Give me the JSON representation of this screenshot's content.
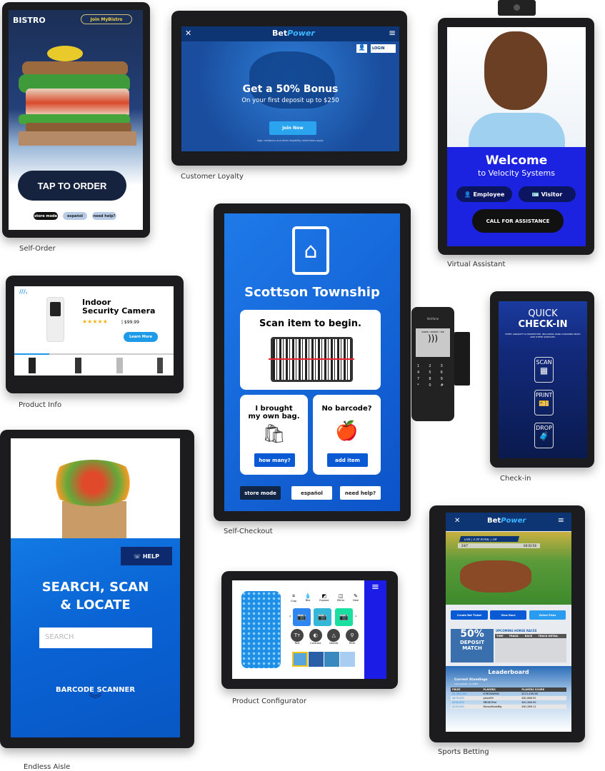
{
  "self_order": {
    "label": "Self-Order",
    "brand": "BISTRO",
    "join": "Join MyBistro",
    "cta": "TAP TO ORDER",
    "buttons": [
      "store mode",
      "español",
      "need help?"
    ]
  },
  "customer_loyalty": {
    "label": "Customer Loyalty",
    "logo_a": "Bet",
    "logo_b": "Power",
    "login": "LOGIN",
    "headline": "Get a 50% Bonus",
    "sub": "On your first deposit up to $250",
    "cta": "Join Now",
    "fine": "Age, residency and other eligibility restrictions apply"
  },
  "virtual_assistant": {
    "label": "Virtual Assistant",
    "welcome": "Welcome",
    "to": "to Velocity Systems",
    "employee": "Employee",
    "visitor": "Visitor",
    "call": "CALL FOR ASSISTANCE"
  },
  "product_info": {
    "label": "Product Info",
    "title1": "Indoor",
    "title2": "Security Camera",
    "stars": "★★★★★",
    "rating": 5,
    "price": "| $99.99",
    "cta": "Learn More",
    "progress": 0.22
  },
  "self_checkout": {
    "label": "Self-Checkout",
    "title": "Scottson Township",
    "scan": "Scan item to begin.",
    "bag_title1": "I brought",
    "bag_title2": "my own bag.",
    "bag_btn": "how many?",
    "nobar_title": "No barcode?",
    "nobar_btn": "add item",
    "footer": [
      "store mode",
      "español",
      "need help?"
    ],
    "reader_brand": "Verifone",
    "reader_screen": "SWIPE / INSERT / TAP",
    "keys": [
      "1",
      "2",
      "3",
      "4",
      "5",
      "6",
      "7",
      "8",
      "9",
      "*",
      "0",
      "#"
    ]
  },
  "check_in": {
    "label": "Check-in",
    "title1": "QUICK",
    "title2": "CHECK-IN",
    "note": "EVERY AIRCRAFT IS DISINFECTED, INCLUDING HAND-CLEANING SEATS AND OTHER SURFACES.",
    "options": [
      "SCAN",
      "PRINT",
      "DROP"
    ]
  },
  "endless_aisle": {
    "label": "Endless Aisle",
    "help": "HELP",
    "title1": "SEARCH, SCAN",
    "title2": "& LOCATE",
    "search_placeholder": "SEARCH",
    "barcode": "BARCODE SCANNER"
  },
  "product_configurator": {
    "label": "Product Configurator",
    "tools": [
      "Crop",
      "Blur",
      "Expand",
      "Mirror",
      "Heal"
    ],
    "effects": [
      "Text",
      "Contrast",
      "Details",
      "Filter"
    ],
    "tile_colors": [
      "#2f86f0",
      "#35b8d8",
      "#19e0a0"
    ]
  },
  "sports_betting": {
    "label": "Sports Betting",
    "logo_a": "Bet",
    "logo_b": "Power",
    "live": "LIVE",
    "race": "2:30 ROYAL",
    "dist": "1M",
    "always": "24/7",
    "timer": "00:03:56",
    "actions": [
      "Create Bet Ticket",
      "View Race",
      "Select Picks"
    ],
    "promo1": "50%",
    "promo2": "DEPOSIT",
    "promo3": "MATCH",
    "upcoming": "UPCOMING HORSE RACES",
    "race_headers": [
      "TIME",
      "TRACK",
      "RACE",
      "TRACK DETAIL"
    ],
    "leaderboard": "Leaderboard",
    "standings": "Current Standings",
    "updated": "Last Update: 11:30PM",
    "lb_headers": [
      "PRIZE",
      "PLAYERS",
      "PLAYERS SCORE"
    ],
    "lb_rows": [
      [
        "$1,000,000",
        "K7BGWW9W",
        "$121,456.98"
      ],
      [
        "$876,000",
        "ghost99",
        "$81,868.52"
      ],
      [
        "$250,000",
        "RBGB3Pad",
        "$61,566.90"
      ],
      [
        "$140,000",
        "MoneyBadsBig",
        "$61,566.11"
      ]
    ]
  }
}
